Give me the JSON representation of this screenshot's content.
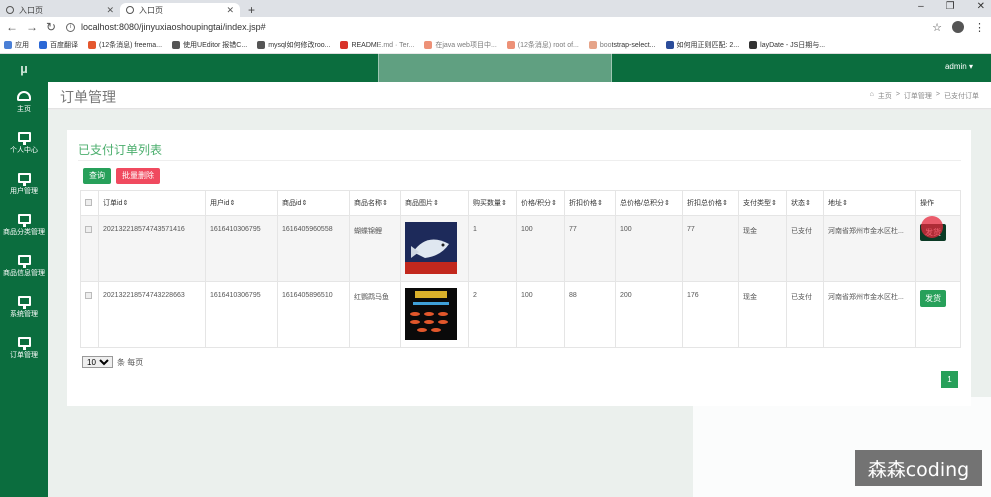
{
  "browser": {
    "tabs": [
      {
        "label": "入口页"
      },
      {
        "label": "入口页"
      }
    ],
    "url": "localhost:8080/jinyuxiaoshoupingtai/index.jsp#",
    "bookmarks": [
      {
        "label": "应用",
        "color": "#4a7fd6"
      },
      {
        "label": "百度翻译",
        "color": "#2b68d6"
      },
      {
        "label": "(12条消息) freema...",
        "color": "#e4572e"
      },
      {
        "label": "使用UEditor 报错C...",
        "color": "#555555"
      },
      {
        "label": "mysql如何修改roo...",
        "color": "#555555"
      },
      {
        "label": "README.md · Ter...",
        "color": "#d8332a"
      },
      {
        "label": "在java web项目中...",
        "color": "#e4572e"
      },
      {
        "label": "(12条消息) root of...",
        "color": "#e4572e"
      },
      {
        "label": "bootstrap-select...",
        "color": "#d9734a"
      },
      {
        "label": "如何用正则匹配: 2...",
        "color": "#2b4c9a"
      },
      {
        "label": "layDate - JS日期与...",
        "color": "#333333"
      }
    ]
  },
  "sidebar": {
    "logo": "µ",
    "items": [
      {
        "label": "主页",
        "icon": "dashboard-icon"
      },
      {
        "label": "个人中心",
        "icon": "monitor-icon"
      },
      {
        "label": "用户管理",
        "icon": "monitor-icon"
      },
      {
        "label": "商品分类管理",
        "icon": "monitor-icon"
      },
      {
        "label": "商品信息管理",
        "icon": "monitor-icon"
      },
      {
        "label": "系统管理",
        "icon": "monitor-icon"
      },
      {
        "label": "订单管理",
        "icon": "monitor-icon"
      }
    ]
  },
  "header": {
    "user": "admin ▾"
  },
  "page": {
    "title": "订单管理",
    "breadcrumb": [
      "主页",
      "订单管理",
      "已支付订单"
    ]
  },
  "card": {
    "title": "已支付订单列表",
    "query_label": "查询",
    "batch_delete_label": "批量删除"
  },
  "table": {
    "headers": [
      "订单id⇕",
      "用户id⇕",
      "商品id⇕",
      "商品名称⇕",
      "商品图片⇕",
      "购买数量⇕",
      "价格/积分⇕",
      "折扣价格⇕",
      "总价格/总积分⇕",
      "折扣总价格⇕",
      "支付类型⇕",
      "状态⇕",
      "地址⇕",
      "操作"
    ],
    "rows": [
      {
        "order_id": "20213221857474357141​6",
        "user_id": "1616410306795",
        "product_id": "1616405960558",
        "name": "蝴蝶锦鲤",
        "qty": "1",
        "price": "100",
        "discount_price": "77",
        "total": "100",
        "discount_total": "77",
        "pay_type": "现金",
        "status": "已支付",
        "address": "河南省郑州市金水区杜...",
        "action": "发货"
      },
      {
        "order_id": "20213221857474322866​3",
        "user_id": "1616410306795",
        "product_id": "1616405896510",
        "name": "红鹦鹉马鱼",
        "qty": "2",
        "price": "100",
        "discount_price": "88",
        "total": "200",
        "discount_total": "176",
        "pay_type": "现金",
        "status": "已支付",
        "address": "河南省郑州市金水区杜...",
        "action": "发货"
      }
    ]
  },
  "pager": {
    "page_size": "10",
    "suffix": "条 每页",
    "current": "1"
  },
  "watermark": "森森coding"
}
